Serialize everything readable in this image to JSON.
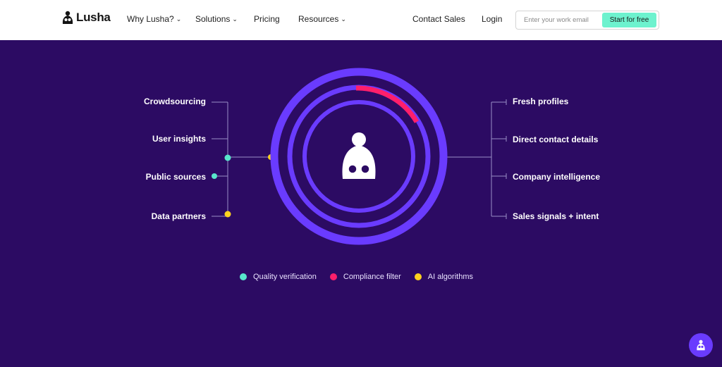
{
  "brand": {
    "name": "Lusha"
  },
  "nav": {
    "items": [
      {
        "label": "Why Lusha?",
        "dropdown": true
      },
      {
        "label": "Solutions",
        "dropdown": true
      },
      {
        "label": "Pricing",
        "dropdown": false
      },
      {
        "label": "Resources",
        "dropdown": true
      }
    ],
    "contact_sales": "Contact Sales",
    "login": "Login"
  },
  "signup": {
    "email_placeholder": "Enter your work email",
    "button_label": "Start for free"
  },
  "diagram": {
    "sources": [
      "Crowdsourcing",
      "User insights",
      "Public sources",
      "Data partners"
    ],
    "outputs": [
      "Fresh profiles",
      "Direct contact details",
      "Company intelligence",
      "Sales signals + intent"
    ]
  },
  "legend": [
    {
      "label": "Quality verification",
      "color": "#58e6cb"
    },
    {
      "label": "Compliance filter",
      "color": "#ff1f6b"
    },
    {
      "label": "AI algorithms",
      "color": "#ffd21f"
    }
  ],
  "colors": {
    "background": "#2c0b63",
    "ring": "#6a3bff",
    "accent_pink": "#ff1f6b",
    "accent_teal": "#58e6cb",
    "accent_yellow": "#ffd21f",
    "cta": "#6df2ce"
  },
  "icons": {
    "chat": "chat-icon",
    "logo": "lusha-logo-icon",
    "center": "glasses-avatar-icon"
  }
}
